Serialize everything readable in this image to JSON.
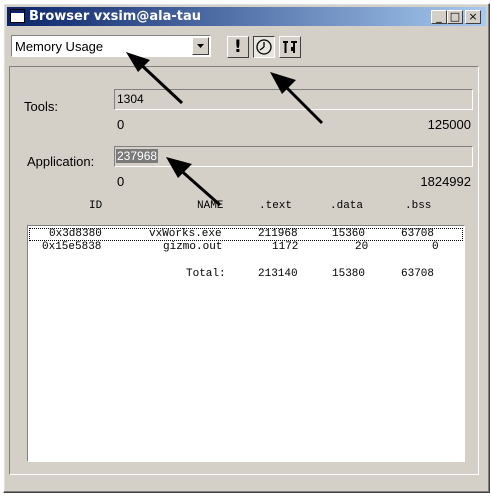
{
  "window": {
    "title": "Browser vxsim@ala-tau"
  },
  "titlebar_buttons": {
    "minimize": "_",
    "maximize": "□",
    "close": "×"
  },
  "toolbar": {
    "selector_value": "Memory Usage",
    "immediate_label": "!",
    "buttons": [
      "dropdown-arrow-icon",
      "immediate-update-icon",
      "periodic-clock-icon",
      "configure-tools-icon"
    ]
  },
  "memory": {
    "tools_label": "Tools:",
    "tools_value": "1304",
    "tools_min": "0",
    "tools_max": "125000",
    "tools_fraction": 0.0104,
    "app_label": "Application:",
    "app_value": "237968",
    "app_min": "0",
    "app_max": "1824992",
    "app_fraction": 0.1304
  },
  "table": {
    "headers": [
      "ID",
      "NAME",
      ".text",
      ".data",
      ".bss"
    ],
    "rows": [
      {
        "id": "0x3d8380",
        "name": "vxWorks.exe",
        "text": "211968",
        "data": "15360",
        "bss": "63708"
      },
      {
        "id": "0x15e5838",
        "name": "gizmo.out",
        "text": "1172",
        "data": "20",
        "bss": "0"
      }
    ],
    "total": {
      "label": "Total:",
      "text": "213140",
      "data": "15380",
      "bss": "63708"
    }
  },
  "colors": {
    "title_start": "#0a246a",
    "title_end": "#a6caf0",
    "face": "#d4d0c8",
    "selection": "#7a7a7a"
  }
}
